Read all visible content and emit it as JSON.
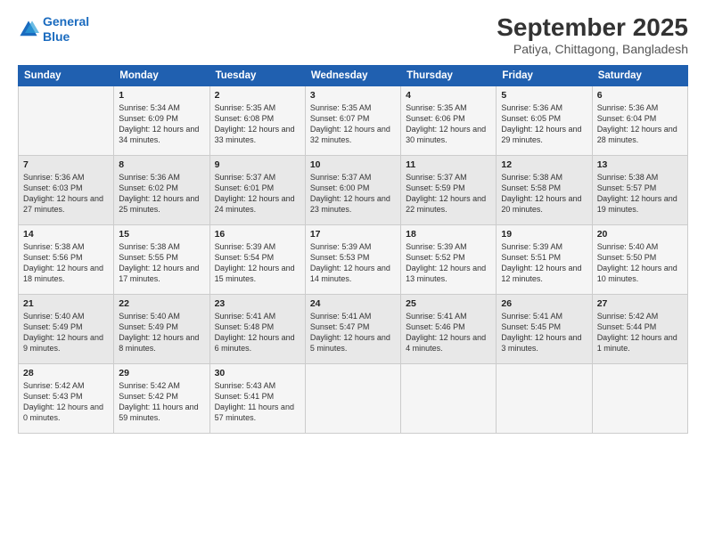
{
  "logo": {
    "line1": "General",
    "line2": "Blue"
  },
  "title": "September 2025",
  "subtitle": "Patiya, Chittagong, Bangladesh",
  "header": {
    "days": [
      "Sunday",
      "Monday",
      "Tuesday",
      "Wednesday",
      "Thursday",
      "Friday",
      "Saturday"
    ]
  },
  "weeks": [
    [
      {
        "day": "",
        "content": ""
      },
      {
        "day": "1",
        "content": "Sunrise: 5:34 AM\nSunset: 6:09 PM\nDaylight: 12 hours\nand 34 minutes."
      },
      {
        "day": "2",
        "content": "Sunrise: 5:35 AM\nSunset: 6:08 PM\nDaylight: 12 hours\nand 33 minutes."
      },
      {
        "day": "3",
        "content": "Sunrise: 5:35 AM\nSunset: 6:07 PM\nDaylight: 12 hours\nand 32 minutes."
      },
      {
        "day": "4",
        "content": "Sunrise: 5:35 AM\nSunset: 6:06 PM\nDaylight: 12 hours\nand 30 minutes."
      },
      {
        "day": "5",
        "content": "Sunrise: 5:36 AM\nSunset: 6:05 PM\nDaylight: 12 hours\nand 29 minutes."
      },
      {
        "day": "6",
        "content": "Sunrise: 5:36 AM\nSunset: 6:04 PM\nDaylight: 12 hours\nand 28 minutes."
      }
    ],
    [
      {
        "day": "7",
        "content": "Sunrise: 5:36 AM\nSunset: 6:03 PM\nDaylight: 12 hours\nand 27 minutes."
      },
      {
        "day": "8",
        "content": "Sunrise: 5:36 AM\nSunset: 6:02 PM\nDaylight: 12 hours\nand 25 minutes."
      },
      {
        "day": "9",
        "content": "Sunrise: 5:37 AM\nSunset: 6:01 PM\nDaylight: 12 hours\nand 24 minutes."
      },
      {
        "day": "10",
        "content": "Sunrise: 5:37 AM\nSunset: 6:00 PM\nDaylight: 12 hours\nand 23 minutes."
      },
      {
        "day": "11",
        "content": "Sunrise: 5:37 AM\nSunset: 5:59 PM\nDaylight: 12 hours\nand 22 minutes."
      },
      {
        "day": "12",
        "content": "Sunrise: 5:38 AM\nSunset: 5:58 PM\nDaylight: 12 hours\nand 20 minutes."
      },
      {
        "day": "13",
        "content": "Sunrise: 5:38 AM\nSunset: 5:57 PM\nDaylight: 12 hours\nand 19 minutes."
      }
    ],
    [
      {
        "day": "14",
        "content": "Sunrise: 5:38 AM\nSunset: 5:56 PM\nDaylight: 12 hours\nand 18 minutes."
      },
      {
        "day": "15",
        "content": "Sunrise: 5:38 AM\nSunset: 5:55 PM\nDaylight: 12 hours\nand 17 minutes."
      },
      {
        "day": "16",
        "content": "Sunrise: 5:39 AM\nSunset: 5:54 PM\nDaylight: 12 hours\nand 15 minutes."
      },
      {
        "day": "17",
        "content": "Sunrise: 5:39 AM\nSunset: 5:53 PM\nDaylight: 12 hours\nand 14 minutes."
      },
      {
        "day": "18",
        "content": "Sunrise: 5:39 AM\nSunset: 5:52 PM\nDaylight: 12 hours\nand 13 minutes."
      },
      {
        "day": "19",
        "content": "Sunrise: 5:39 AM\nSunset: 5:51 PM\nDaylight: 12 hours\nand 12 minutes."
      },
      {
        "day": "20",
        "content": "Sunrise: 5:40 AM\nSunset: 5:50 PM\nDaylight: 12 hours\nand 10 minutes."
      }
    ],
    [
      {
        "day": "21",
        "content": "Sunrise: 5:40 AM\nSunset: 5:49 PM\nDaylight: 12 hours\nand 9 minutes."
      },
      {
        "day": "22",
        "content": "Sunrise: 5:40 AM\nSunset: 5:49 PM\nDaylight: 12 hours\nand 8 minutes."
      },
      {
        "day": "23",
        "content": "Sunrise: 5:41 AM\nSunset: 5:48 PM\nDaylight: 12 hours\nand 6 minutes."
      },
      {
        "day": "24",
        "content": "Sunrise: 5:41 AM\nSunset: 5:47 PM\nDaylight: 12 hours\nand 5 minutes."
      },
      {
        "day": "25",
        "content": "Sunrise: 5:41 AM\nSunset: 5:46 PM\nDaylight: 12 hours\nand 4 minutes."
      },
      {
        "day": "26",
        "content": "Sunrise: 5:41 AM\nSunset: 5:45 PM\nDaylight: 12 hours\nand 3 minutes."
      },
      {
        "day": "27",
        "content": "Sunrise: 5:42 AM\nSunset: 5:44 PM\nDaylight: 12 hours\nand 1 minute."
      }
    ],
    [
      {
        "day": "28",
        "content": "Sunrise: 5:42 AM\nSunset: 5:43 PM\nDaylight: 12 hours\nand 0 minutes."
      },
      {
        "day": "29",
        "content": "Sunrise: 5:42 AM\nSunset: 5:42 PM\nDaylight: 11 hours\nand 59 minutes."
      },
      {
        "day": "30",
        "content": "Sunrise: 5:43 AM\nSunset: 5:41 PM\nDaylight: 11 hours\nand 57 minutes."
      },
      {
        "day": "",
        "content": ""
      },
      {
        "day": "",
        "content": ""
      },
      {
        "day": "",
        "content": ""
      },
      {
        "day": "",
        "content": ""
      }
    ]
  ]
}
